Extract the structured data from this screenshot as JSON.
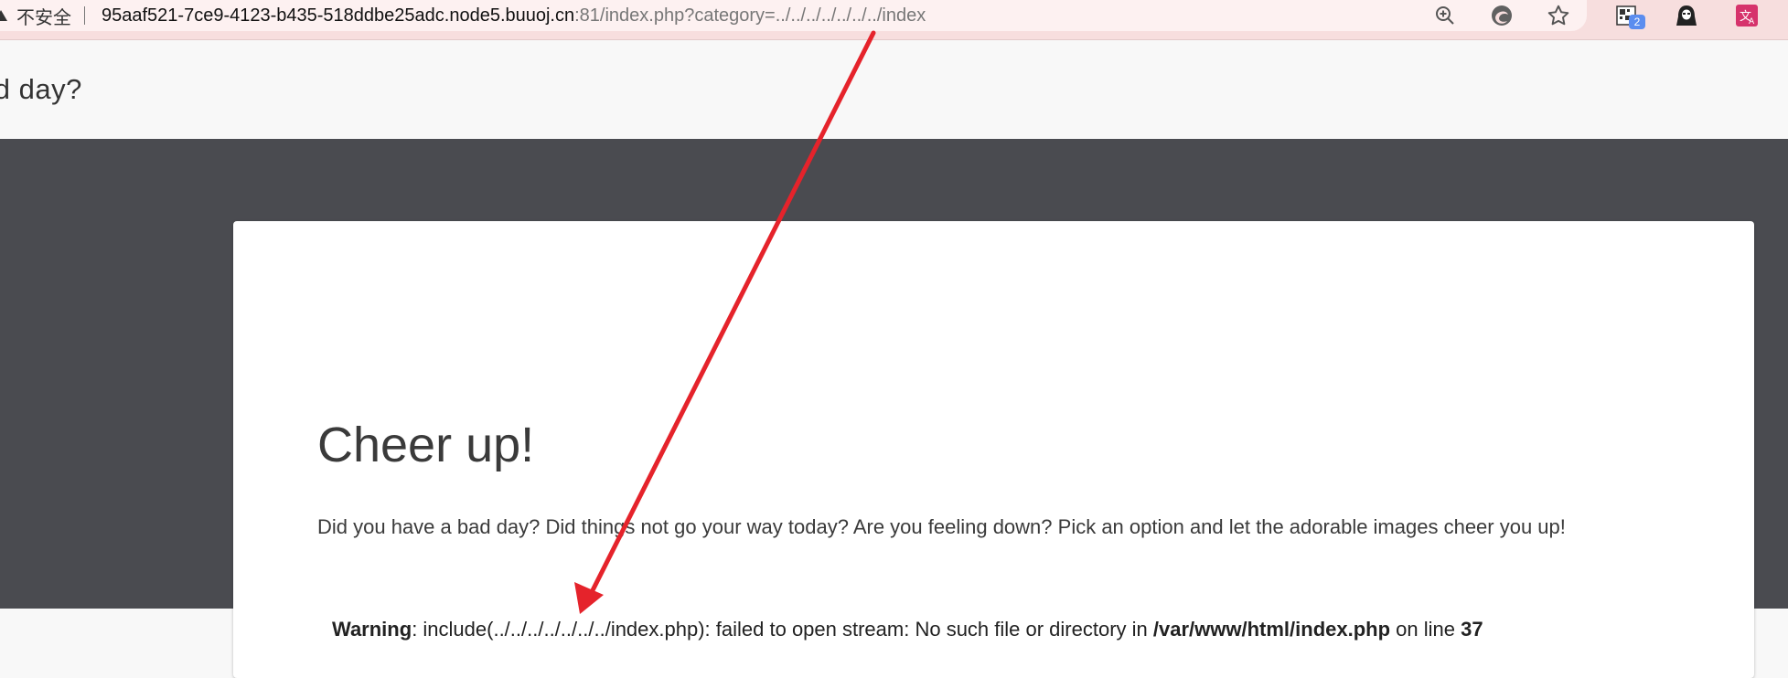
{
  "browser": {
    "security_label": "不安全",
    "url_host": "95aaf521-7ce9-4123-b435-518ddbe25adc.node5.buuoj.cn",
    "url_rest": ":81/index.php?category=../../../../../../../index",
    "extension_badge": "2",
    "icons": [
      "warning-triangle-icon",
      "zoom-in-icon",
      "edge-refresh-icon",
      "star-icon",
      "qr-extension-icon",
      "hacker-extension-icon",
      "translate-icon"
    ]
  },
  "header": {
    "title": "ad day?"
  },
  "card": {
    "title": "Cheer up!",
    "text": "Did you have a bad day? Did things not go your way today? Are you feeling down? Pick an option and let the adorable images cheer you up!"
  },
  "warning": {
    "label": "Warning",
    "message": ": include(../../../../../../../index.php): failed to open stream: No such file or directory in ",
    "path": "/var/www/html/index.php",
    "on_line": " on line ",
    "line": "37"
  },
  "colors": {
    "addressbar_bg": "#f7dede",
    "dark_band": "#4a4b50",
    "arrow": "#e5232b"
  }
}
